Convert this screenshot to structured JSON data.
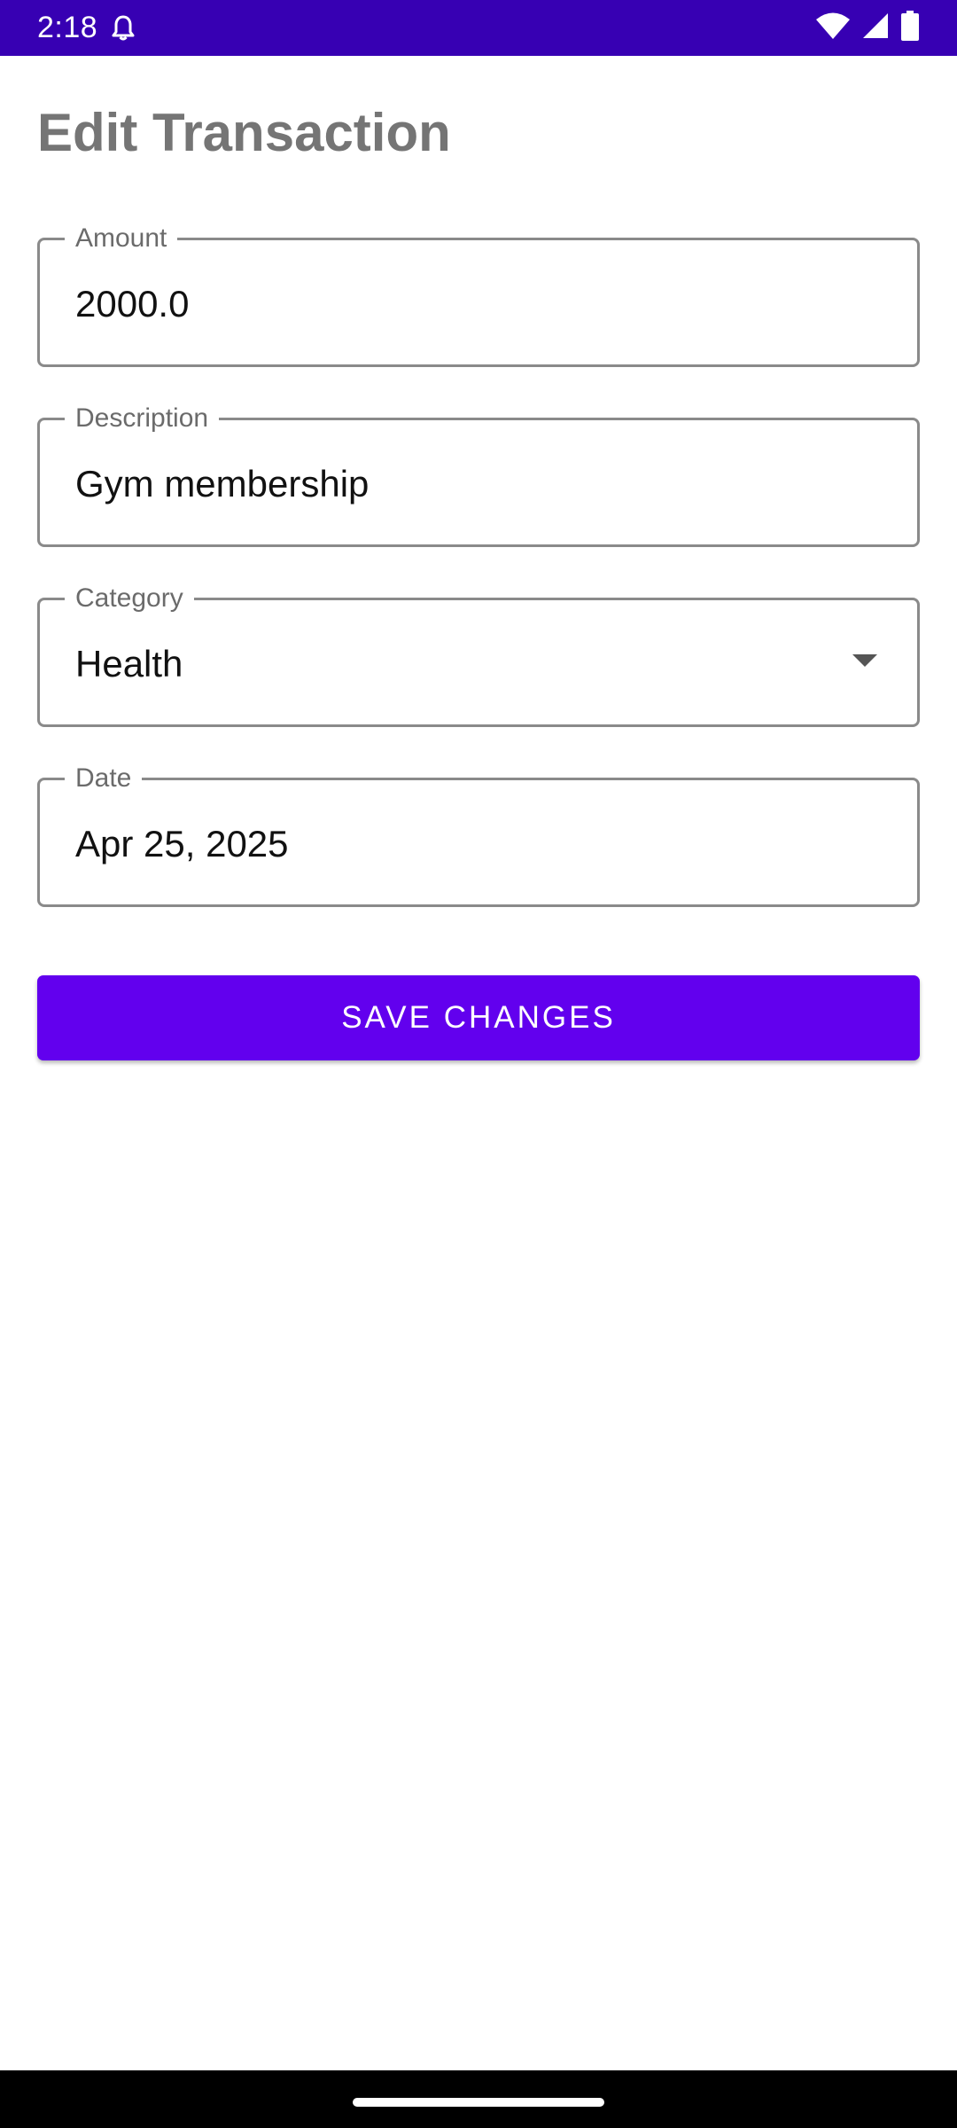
{
  "status_bar": {
    "time": "2:18",
    "icons": [
      "bell-icon",
      "wifi-icon",
      "signal-icon",
      "battery-icon"
    ],
    "background": "#3700b3"
  },
  "page": {
    "title": "Edit Transaction"
  },
  "form": {
    "amount": {
      "label": "Amount",
      "value": "2000.0"
    },
    "description": {
      "label": "Description",
      "value": "Gym membership"
    },
    "category": {
      "label": "Category",
      "value": "Health",
      "icon": "dropdown-arrow-icon"
    },
    "date": {
      "label": "Date",
      "value": "Apr 25, 2025"
    }
  },
  "actions": {
    "save_label": "SAVE CHANGES",
    "accent": "#6200ee"
  }
}
